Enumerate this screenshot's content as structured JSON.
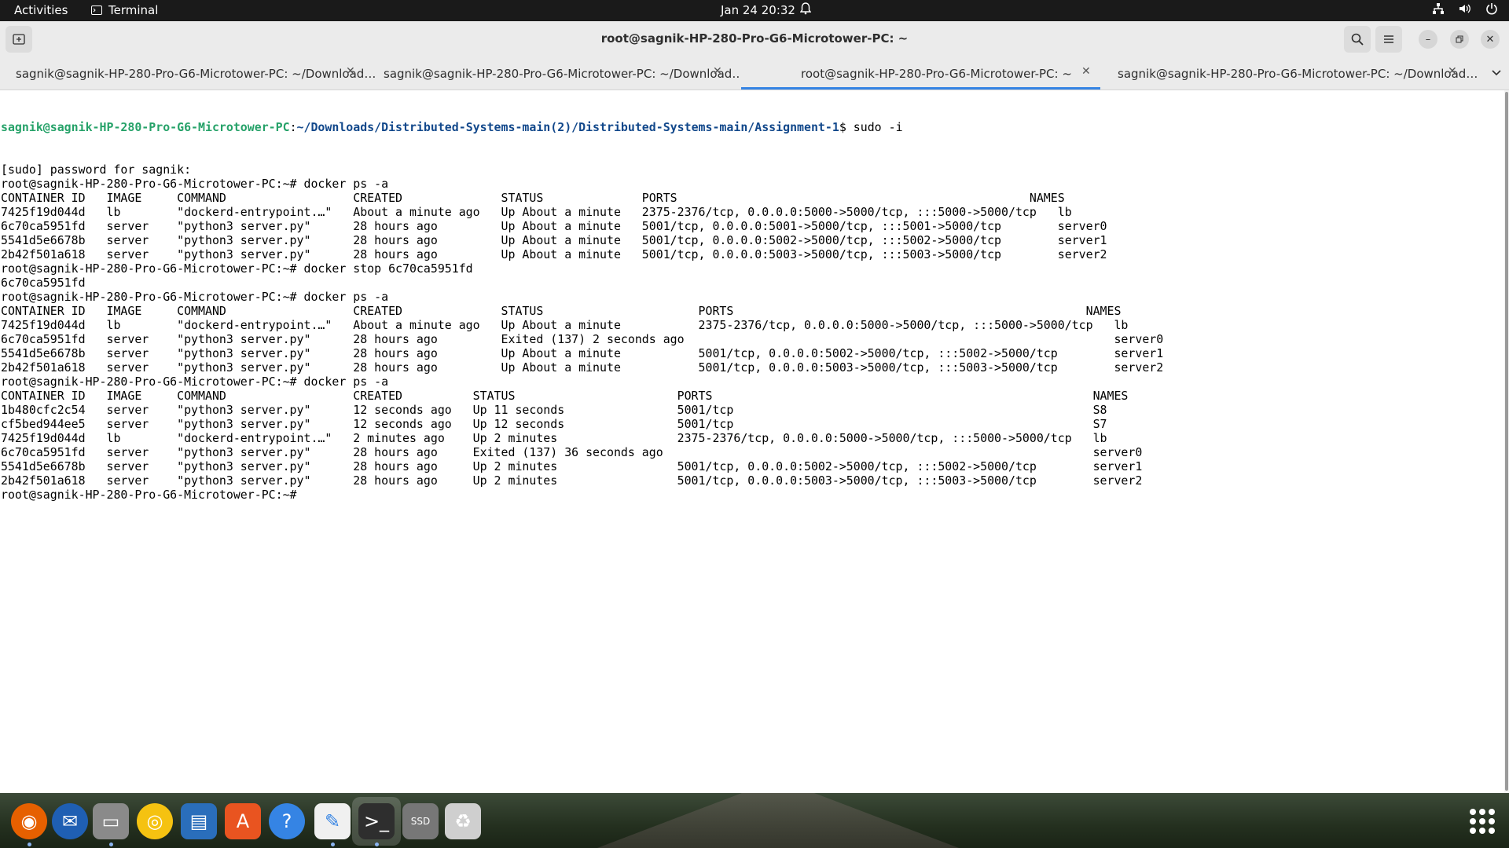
{
  "topbar": {
    "activities": "Activities",
    "app_name": "Terminal",
    "clock": "Jan 24  20:32"
  },
  "window": {
    "title": "root@sagnik-HP-280-Pro-G6-Microtower-PC: ~"
  },
  "tabs": [
    {
      "label": "sagnik@sagnik-HP-280-Pro-G6-Microtower-PC: ~/Download…",
      "active": false
    },
    {
      "label": "sagnik@sagnik-HP-280-Pro-G6-Microtower-PC: ~/Download…",
      "active": false
    },
    {
      "label": "root@sagnik-HP-280-Pro-G6-Microtower-PC: ~",
      "active": true
    },
    {
      "label": "sagnik@sagnik-HP-280-Pro-G6-Microtower-PC: ~/Download…",
      "active": false
    }
  ],
  "terminal": {
    "first_prompt": {
      "user": "sagnik@sagnik-HP-280-Pro-G6-Microtower-PC",
      "path": "~/Downloads/Distributed-Systems-main(2)/Distributed-Systems-main/Assignment-1",
      "command": "$ sudo -i"
    },
    "lines": [
      "[sudo] password for sagnik:",
      "root@sagnik-HP-280-Pro-G6-Microtower-PC:~# docker ps -a",
      "CONTAINER ID   IMAGE     COMMAND                  CREATED              STATUS              PORTS                                                  NAMES",
      "7425f19d044d   lb        \"dockerd-entrypoint.…\"   About a minute ago   Up About a minute   2375-2376/tcp, 0.0.0.0:5000->5000/tcp, :::5000->5000/tcp   lb",
      "6c70ca5951fd   server    \"python3 server.py\"      28 hours ago         Up About a minute   5001/tcp, 0.0.0.0:5001->5000/tcp, :::5001->5000/tcp        server0",
      "5541d5e6678b   server    \"python3 server.py\"      28 hours ago         Up About a minute   5001/tcp, 0.0.0.0:5002->5000/tcp, :::5002->5000/tcp        server1",
      "2b42f501a618   server    \"python3 server.py\"      28 hours ago         Up About a minute   5001/tcp, 0.0.0.0:5003->5000/tcp, :::5003->5000/tcp        server2",
      "root@sagnik-HP-280-Pro-G6-Microtower-PC:~# docker stop 6c70ca5951fd",
      "6c70ca5951fd",
      "root@sagnik-HP-280-Pro-G6-Microtower-PC:~# docker ps -a",
      "CONTAINER ID   IMAGE     COMMAND                  CREATED              STATUS                      PORTS                                                  NAMES",
      "7425f19d044d   lb        \"dockerd-entrypoint.…\"   About a minute ago   Up About a minute           2375-2376/tcp, 0.0.0.0:5000->5000/tcp, :::5000->5000/tcp   lb",
      "6c70ca5951fd   server    \"python3 server.py\"      28 hours ago         Exited (137) 2 seconds ago                                                             server0",
      "5541d5e6678b   server    \"python3 server.py\"      28 hours ago         Up About a minute           5001/tcp, 0.0.0.0:5002->5000/tcp, :::5002->5000/tcp        server1",
      "2b42f501a618   server    \"python3 server.py\"      28 hours ago         Up About a minute           5001/tcp, 0.0.0.0:5003->5000/tcp, :::5003->5000/tcp        server2",
      "root@sagnik-HP-280-Pro-G6-Microtower-PC:~# docker ps -a",
      "CONTAINER ID   IMAGE     COMMAND                  CREATED          STATUS                       PORTS                                                      NAMES",
      "1b480cfc2c54   server    \"python3 server.py\"      12 seconds ago   Up 11 seconds                5001/tcp                                                   S8",
      "cf5bed944ee5   server    \"python3 server.py\"      12 seconds ago   Up 12 seconds                5001/tcp                                                   S7",
      "7425f19d044d   lb        \"dockerd-entrypoint.…\"   2 minutes ago    Up 2 minutes                 2375-2376/tcp, 0.0.0.0:5000->5000/tcp, :::5000->5000/tcp   lb",
      "6c70ca5951fd   server    \"python3 server.py\"      28 hours ago     Exited (137) 36 seconds ago                                                             server0",
      "5541d5e6678b   server    \"python3 server.py\"      28 hours ago     Up 2 minutes                 5001/tcp, 0.0.0.0:5002->5000/tcp, :::5002->5000/tcp        server1",
      "2b42f501a618   server    \"python3 server.py\"      28 hours ago     Up 2 minutes                 5001/tcp, 0.0.0.0:5003->5000/tcp, :::5003->5000/tcp        server2",
      "root@sagnik-HP-280-Pro-G6-Microtower-PC:~# "
    ]
  },
  "dock": {
    "apps": [
      {
        "name": "firefox-icon",
        "color": "#e66000",
        "glyph": "◉",
        "running": true
      },
      {
        "name": "thunderbird-icon",
        "color": "#1f5fb3",
        "glyph": "✉",
        "running": false
      },
      {
        "name": "files-icon",
        "color": "#8a8a8a",
        "glyph": "▭",
        "running": true
      },
      {
        "name": "rhythmbox-icon",
        "color": "#f5c211",
        "glyph": "◎",
        "running": false
      },
      {
        "name": "libreoffice-writer-icon",
        "color": "#2a6ebb",
        "glyph": "▤",
        "running": false
      },
      {
        "name": "app-center-icon",
        "color": "#e95420",
        "glyph": "A",
        "running": false
      },
      {
        "name": "help-icon",
        "color": "#3584e4",
        "glyph": "?",
        "running": false
      },
      {
        "name": "text-editor-icon",
        "color": "#f0f0f0",
        "glyph": "✎",
        "running": true
      },
      {
        "name": "terminal-icon",
        "color": "#2e2e2e",
        "glyph": ">_",
        "running": true
      },
      {
        "name": "ssd-drive-icon",
        "color": "#777777",
        "glyph": "SSD",
        "running": false
      },
      {
        "name": "trash-icon",
        "color": "#cfcfcf",
        "glyph": "♻",
        "running": false
      }
    ],
    "show_apps": "show-apps-grid-icon"
  }
}
